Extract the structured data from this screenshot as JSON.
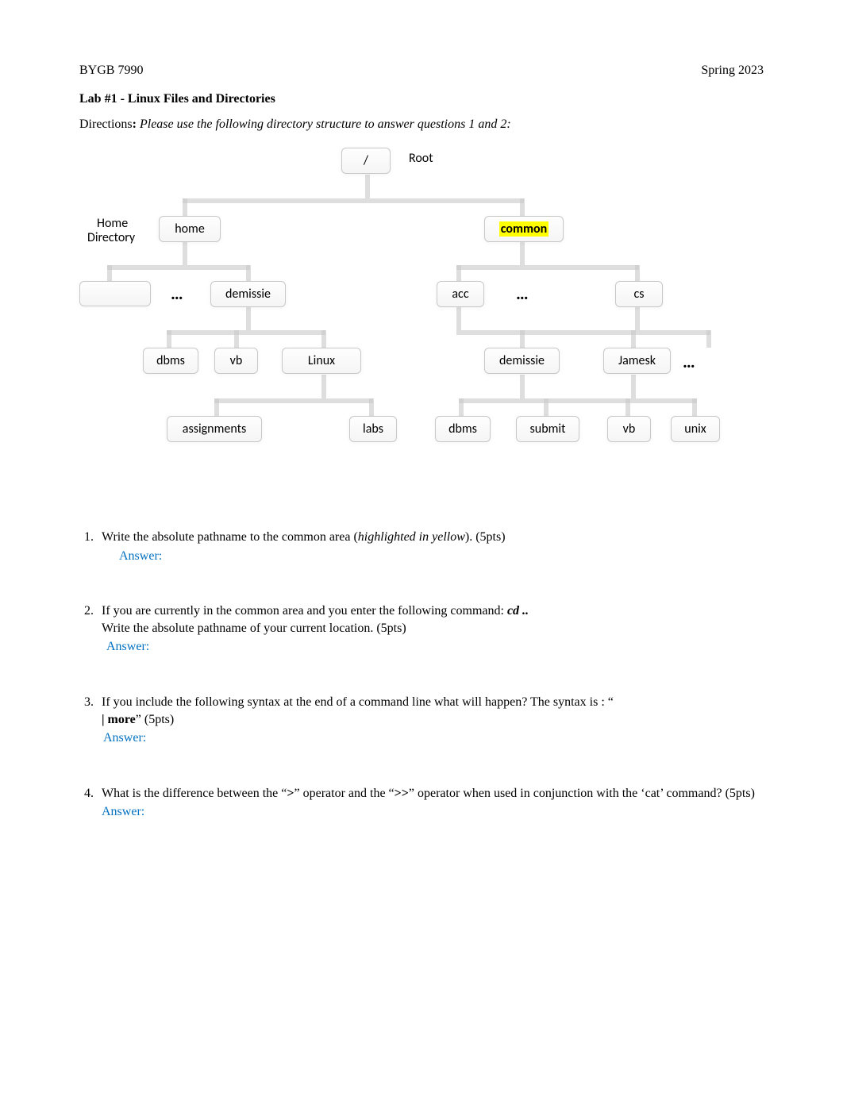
{
  "header": {
    "course": "BYGB 7990",
    "term": "Spring 2023"
  },
  "title": "Lab #1 - Linux Files and Directories",
  "directions": {
    "lead": "Directions",
    "colon": ":",
    "text": "Please use the following directory structure to answer questions 1 and 2:"
  },
  "diagram": {
    "root_slash": "/",
    "root_label": "Root",
    "home_dir_label1": "Home",
    "home_dir_label2": "Directory",
    "home": "home",
    "common": "common",
    "demissie": "demissie",
    "acc": "acc",
    "cs": "cs",
    "dbms": "dbms",
    "vb": "vb",
    "linux": "Linux",
    "demissie2": "demissie",
    "jamesk": "Jamesk",
    "assignments": "assignments",
    "labs": "labs",
    "dbms2": "dbms",
    "submit": "submit",
    "vb2": "vb",
    "unix": "unix",
    "ellipsis": "…"
  },
  "questions": {
    "q1": {
      "num": "1.",
      "text_pre": "Write the absolute pathname to the common area (",
      "text_italic": "highlighted in yellow",
      "text_post": "). (5pts)",
      "answer_label": "Answer:"
    },
    "q2": {
      "num": "2.",
      "line1_pre": "If you are currently in the common area and you enter the following command:   ",
      "line1_cmd": "cd ..",
      "line2": "Write the absolute pathname of your current location. (5pts)",
      "answer_label": "Answer:"
    },
    "q3": {
      "num": "3.",
      "line1": "If you include the following syntax at the end of a command line what will happen?  The syntax is : “",
      "line2_bold": "| more",
      "line2_rest": "” (5pts)",
      "answer_label": "Answer:"
    },
    "q4": {
      "num": "4.",
      "text_pre": "What is the difference between the “",
      "text_b1": ">",
      "text_mid": "” operator and the “",
      "text_b2": ">>",
      "text_post": "” operator when used in conjunction with the ‘cat’ command? (5pts)",
      "answer_label": "Answer:"
    }
  }
}
